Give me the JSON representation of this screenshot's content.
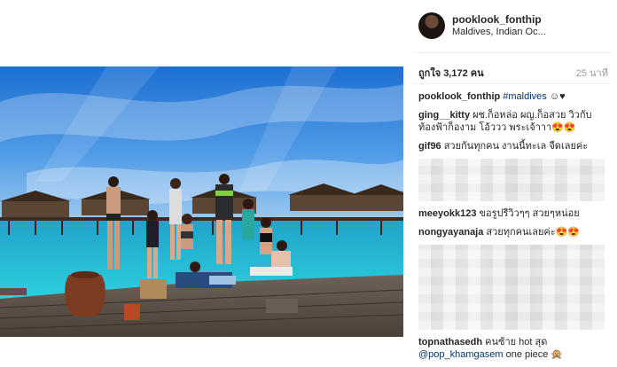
{
  "post": {
    "username": "pooklook_fonthip",
    "location": "Maldives, Indian Oc...",
    "likes": "ถูกใจ 3,172 คน",
    "time": "25 นาที",
    "photo_label": "Group photo on a wooden pier over turquoise water with overwater bungalows in the Maldives"
  },
  "caption": {
    "username": "pooklook_fonthip",
    "hashtag": "#maldives",
    "emoji": "☺♥"
  },
  "comments": [
    {
      "user": "ging__kitty",
      "text": "ผช.ก็อหล่อ ผญ.ก็อสวย วิวกับท้องฟ้าก็องาม โอ้ววว พระเจ้าาา😍😍"
    },
    {
      "user": "gif96",
      "text": "สวยกันทุกคน งานนี้ทะเล จืดเลยค่ะ"
    },
    {
      "user": "meeyokk123",
      "text": "ขอรูปรีวิวๆๆ สวยๆหน่อย"
    },
    {
      "user": "nongyayanaja",
      "text": "สวยทุกคนเลยค่ะ😍😍"
    },
    {
      "user": "topnathasedh",
      "text": "คนซ้าย hot สุด",
      "mention": "@pop_khamgasem",
      "mention_text": "one piece 🙊"
    }
  ]
}
